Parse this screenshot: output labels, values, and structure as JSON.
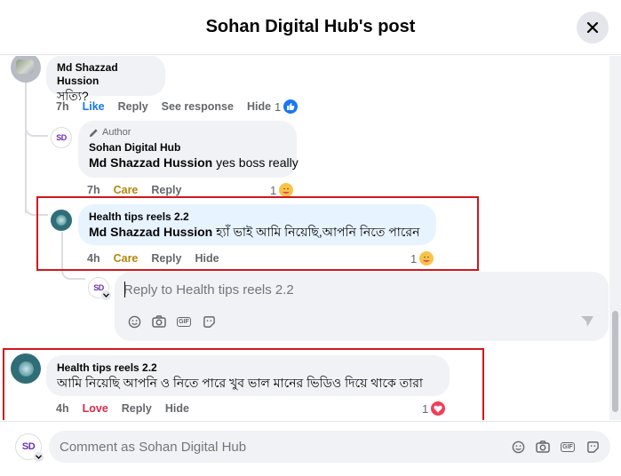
{
  "header": {
    "title": "Sohan Digital Hub's post"
  },
  "comments": [
    {
      "author": "Md Shazzad Hussion",
      "text": "সত্যি?",
      "time": "7h",
      "actions": {
        "like": "Like",
        "reply": "Reply",
        "see_response": "See response",
        "hide": "Hide"
      },
      "reaction_count": "1",
      "reaction_type": "like"
    },
    {
      "author_badge": "Author",
      "author": "Sohan Digital Hub",
      "mention": "Md Shazzad Hussion",
      "text": " yes boss really",
      "time": "7h",
      "actions": {
        "react": "Care",
        "reply": "Reply"
      },
      "reaction_count": "1",
      "reaction_type": "care"
    },
    {
      "author": "Health tips reels 2.2",
      "mention": "Md Shazzad Hussion",
      "text": " হ্যাঁ ভাই আমি নিয়েছি,আপনি নিতে পারেন",
      "time": "4h",
      "actions": {
        "react": "Care",
        "reply": "Reply",
        "hide": "Hide"
      },
      "reaction_count": "1",
      "reaction_type": "care"
    },
    {
      "author": "Health tips reels 2.2",
      "text": "আমি নিয়েছি আপনি ও নিতে পারে খুব ভাল মানের ভিডিও দিয়ে থাকে তারা",
      "time": "4h",
      "actions": {
        "react": "Love",
        "reply": "Reply",
        "hide": "Hide"
      },
      "reaction_count": "1",
      "reaction_type": "love"
    }
  ],
  "reply_box": {
    "placeholder": "Reply to Health tips reels 2.2"
  },
  "footer": {
    "placeholder": "Comment as Sohan Digital Hub"
  },
  "colors": {
    "link_blue": "#1877f2",
    "care_yellow": "#b3870c",
    "love_red": "#d92c4a",
    "highlight_box": "#d0181c",
    "bubble_bg": "#f0f2f5",
    "highlight_bubble": "#e7f3ff"
  },
  "icons": [
    "close-icon",
    "thumbs-up-icon",
    "care-emoji-icon",
    "heart-icon",
    "emoji-icon",
    "camera-icon",
    "gif-icon",
    "sticker-icon",
    "send-icon",
    "pencil-icon",
    "chevron-down-icon"
  ]
}
